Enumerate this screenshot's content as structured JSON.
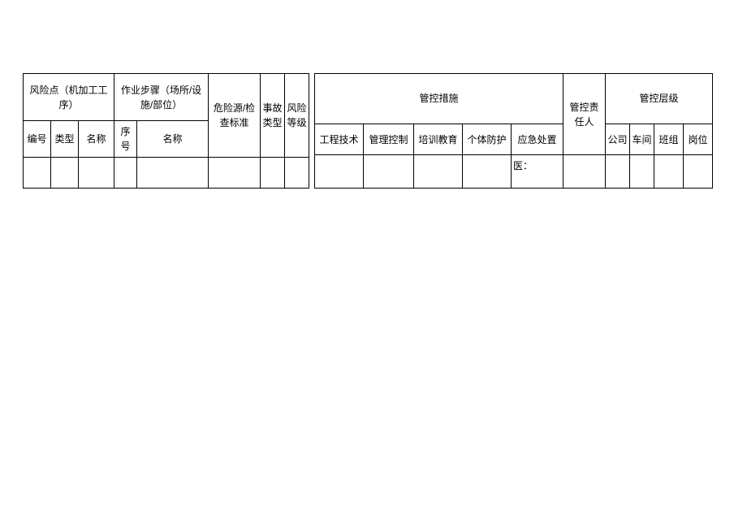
{
  "left": {
    "group_risk_point": "风险点（机加工工序）",
    "group_work_step": "作业步骤（场所/设施/部位）",
    "col_hazard_check": "危险源/检查标准",
    "col_accident_type": "事故类型",
    "col_risk_level": "风险等级",
    "sub_number": "编号",
    "sub_type": "类型",
    "sub_name1": "名称",
    "sub_seq": "序号",
    "sub_name2": "名称"
  },
  "right": {
    "group_measures": "管控措施",
    "col_responsible": "管控责任人",
    "group_level": "管控层级",
    "sub_eng_tech": "工程技术",
    "sub_mgmt_ctrl": "管理控制",
    "sub_training": "培训教育",
    "sub_ppe": "个体防护",
    "sub_emergency": "应急处置",
    "sub_company": "公司",
    "sub_workshop": "车间",
    "sub_team": "班组",
    "sub_post": "岗位",
    "row_emergency_val": "医："
  }
}
